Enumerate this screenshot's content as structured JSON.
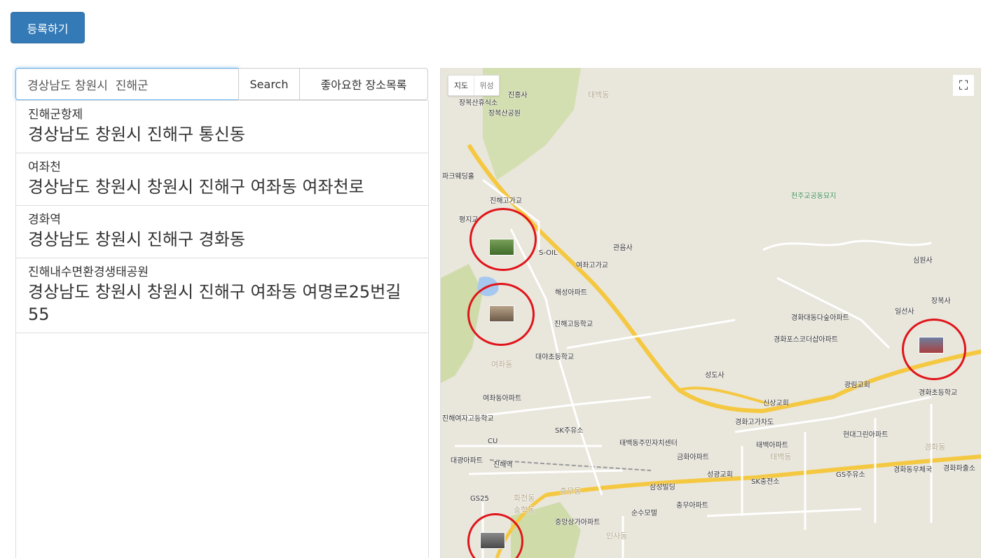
{
  "register_button": "등록하기",
  "search": {
    "value": "경상남도 창원시  진해군",
    "search_button": "Search",
    "favorites_button": "좋아요한 장소목록"
  },
  "results": [
    {
      "name": "진해군항제",
      "address": "경상남도 창원시 진해구 통신동"
    },
    {
      "name": "여좌천",
      "address": "경상남도 창원시 창원시 진해구 여좌동 여좌천로"
    },
    {
      "name": "경화역",
      "address": "경상남도 창원시 진해구 경화동"
    },
    {
      "name": "진해내수면환경생태공원",
      "address": "경상남도 창원시 창원시 진해구 여좌동 여명로25번길 55"
    }
  ],
  "map": {
    "type_map": "지도",
    "type_satellite": "위성",
    "fullscreen_icon": "fullscreen-icon",
    "marker_color": "#e0141a",
    "labels": [
      "진흥사",
      "태백동",
      "장복산휴식소",
      "장복산공원",
      "파크웨딩홀",
      "진해고가교",
      "평지교",
      "S-OIL",
      "관음사",
      "여좌고가교",
      "해성아파트",
      "진해고등학교",
      "대야초등학교",
      "여좌동",
      "여좌동아파트",
      "진해여자고등학교",
      "SK주유소",
      "CU",
      "대광아파트",
      "진해역",
      "태백동주민자치센터",
      "금화아파트",
      "성광교회",
      "SK충전소",
      "GS주유소",
      "경화동우체국",
      "경화파출소",
      "삼성빌딩",
      "충무아파트",
      "순수모텔",
      "중앙상가아파트",
      "GS25",
      "충무동",
      "화천동",
      "송학동",
      "인사동",
      "천주교공동묘지",
      "심원사",
      "장복사",
      "일선사",
      "경화대동다숲아파트",
      "경화포스코더샵아파트",
      "성도사",
      "신상교회",
      "경화고가차도",
      "태백아파트",
      "현대그린아파트",
      "광림교회",
      "경화초등학교",
      "경화동",
      "태백동"
    ]
  }
}
